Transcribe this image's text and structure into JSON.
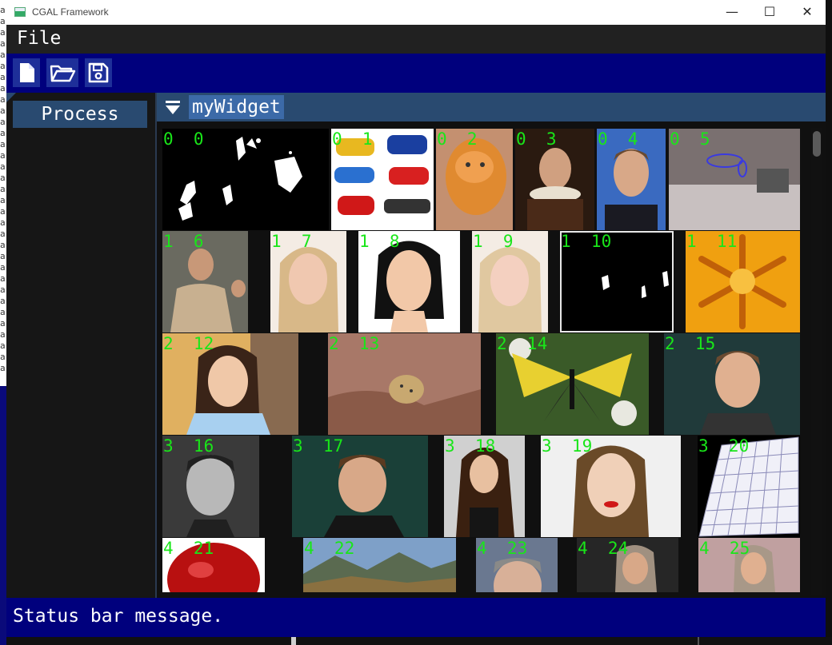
{
  "window": {
    "title": "CGAL Framework",
    "minimize": "—",
    "maximize": "☐",
    "close": "✕"
  },
  "background_terminal": {
    "chars": "a\na\na\na\na\na\na\na\na\na\na\na\na\na\na\na\na\na\na\na\na\na\na\na\na\na\na\na\na\na\na\na\na"
  },
  "menu": {
    "file_label": "File"
  },
  "toolbar": {
    "icons": [
      "new-file-icon",
      "open-folder-icon",
      "save-icon"
    ]
  },
  "left_panel": {
    "process_label": "Process"
  },
  "widget": {
    "title": "myWidget"
  },
  "thumbnails": [
    {
      "label": "0  0",
      "subject": "black-white-mask"
    },
    {
      "label": "0  1",
      "subject": "cars"
    },
    {
      "label": "0  2",
      "subject": "cat"
    },
    {
      "label": "0  3",
      "subject": "portrait-painting"
    },
    {
      "label": "0  4",
      "subject": "man-portrait"
    },
    {
      "label": "0  5",
      "subject": "room-scene"
    },
    {
      "label": "1  6",
      "subject": "man-jacket"
    },
    {
      "label": "1  7",
      "subject": "blonde-woman"
    },
    {
      "label": "1  8",
      "subject": "drawn-woman"
    },
    {
      "label": "1  9",
      "subject": "blonde-woman-2"
    },
    {
      "label": "1  10",
      "subject": "black-mask"
    },
    {
      "label": "1  11",
      "subject": "snowflake"
    },
    {
      "label": "2  12",
      "subject": "woman-smiling"
    },
    {
      "label": "2  13",
      "subject": "ocelot"
    },
    {
      "label": "2  14",
      "subject": "butterfly"
    },
    {
      "label": "2  15",
      "subject": "young-man"
    },
    {
      "label": "3  16",
      "subject": "young-man-gray"
    },
    {
      "label": "3  17",
      "subject": "man-dark"
    },
    {
      "label": "3  18",
      "subject": "woman-long-hair"
    },
    {
      "label": "3  19",
      "subject": "woman-red-lips"
    },
    {
      "label": "3  20",
      "subject": "grid-warp"
    },
    {
      "label": "4  21",
      "subject": "apple"
    },
    {
      "label": "4  22",
      "subject": "mountains"
    },
    {
      "label": "4  23",
      "subject": "man-partial"
    },
    {
      "label": "4  24",
      "subject": "woman-headscarf"
    },
    {
      "label": "4  25",
      "subject": "woman-headscarf-2"
    }
  ],
  "status": {
    "message": "Status bar message."
  }
}
